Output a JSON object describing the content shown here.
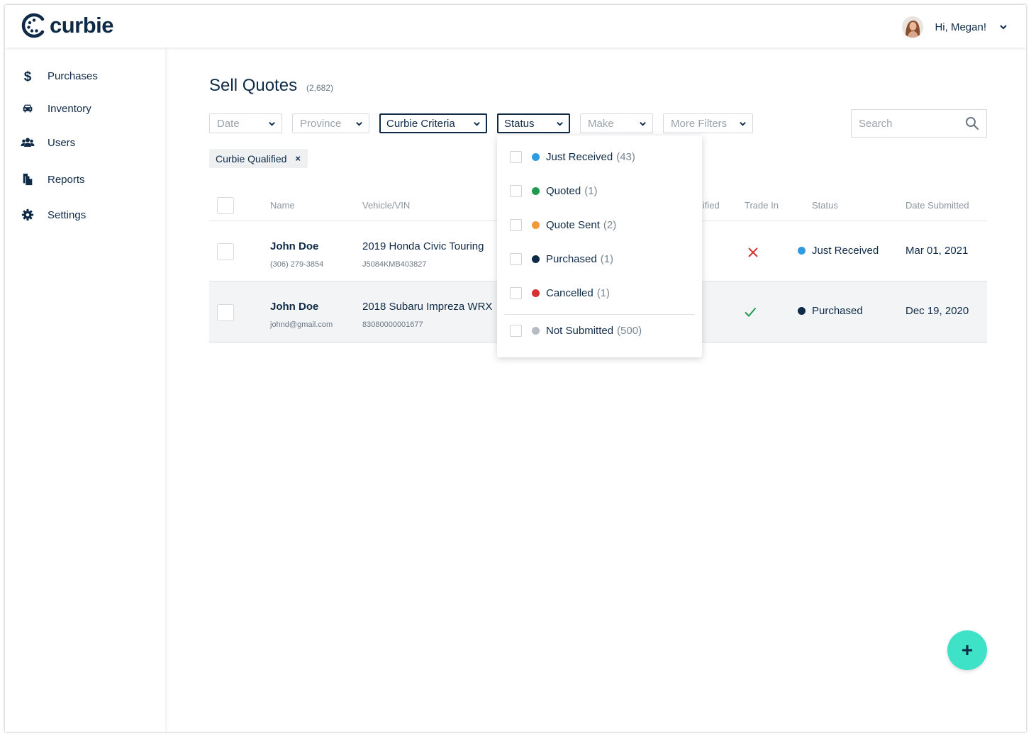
{
  "brand": {
    "name": "curbie"
  },
  "header": {
    "greeting": "Hi, Megan!"
  },
  "sidebar": {
    "items": [
      {
        "label": "Purchases",
        "icon": "dollar-icon"
      },
      {
        "label": "Inventory",
        "icon": "car-icon"
      },
      {
        "label": "Users",
        "icon": "users-icon"
      },
      {
        "label": "Reports",
        "icon": "reports-icon"
      },
      {
        "label": "Settings",
        "icon": "gear-icon"
      }
    ]
  },
  "page": {
    "title": "Sell Quotes",
    "count": "(2,682)"
  },
  "filters": {
    "date": "Date",
    "province": "Province",
    "criteria": "Curbie Criteria",
    "status": "Status",
    "make": "Make",
    "more": "More Filters"
  },
  "search": {
    "placeholder": "Search"
  },
  "chip": {
    "label": "Curbie Qualified",
    "remove": "×"
  },
  "table": {
    "headers": {
      "name": "Name",
      "vehicle": "Vehicle/VIN",
      "qualified": "lified",
      "trade_in": "Trade In",
      "status": "Status",
      "date": "Date Submitted"
    },
    "rows": [
      {
        "name": "John Doe",
        "contact": "(306) 279-3854",
        "vehicle": "2019 Honda Civic Touring",
        "vin": "J5084KMB403827",
        "trade_in": "no",
        "status": "Just Received",
        "status_color": "#2f9be0",
        "date": "Mar 01, 2021"
      },
      {
        "name": "John Doe",
        "contact": "johnd@gmail.com",
        "vehicle": "2018 Subaru Impreza WRX",
        "vin": "83080000001677",
        "trade_in": "yes",
        "status": "Purchased",
        "status_color": "#0e2a47",
        "date": "Dec 19, 2020"
      }
    ]
  },
  "status_dropdown": {
    "options": [
      {
        "label": "Just Received",
        "count": "(43)",
        "color": "#2f9be0"
      },
      {
        "label": "Quoted",
        "count": "(1)",
        "color": "#1f9a4f"
      },
      {
        "label": "Quote Sent",
        "count": "(2)",
        "color": "#f29a3b"
      },
      {
        "label": "Purchased",
        "count": "(1)",
        "color": "#0e2a47"
      },
      {
        "label": "Cancelled",
        "count": "(1)",
        "color": "#d63232"
      },
      {
        "label": "Not Submitted",
        "count": "(500)",
        "color": "#b7bcc2"
      }
    ]
  },
  "fab": {
    "label": "+"
  },
  "colors": {
    "navy": "#0e2a47",
    "accent": "#3ee2c6",
    "error": "#d63232",
    "success": "#1f9a4f"
  }
}
